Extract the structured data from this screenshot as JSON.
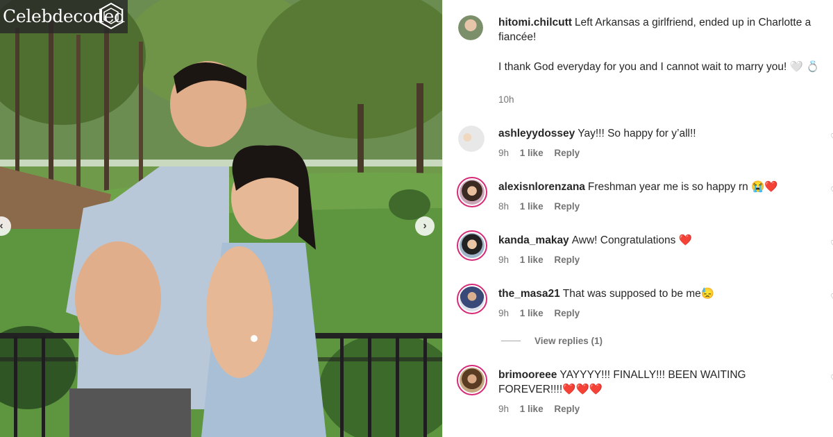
{
  "watermark": {
    "text": "Celebdecoded"
  },
  "photo": {
    "prev_icon": "chevron-left-icon",
    "next_icon": "chevron-right-icon"
  },
  "caption": {
    "username": "hitomi.chilcutt",
    "line1": "Left Arkansas a girlfriend, ended up in Charlotte a fiancée!",
    "line2": "I thank God everyday for you and I cannot wait to marry you! 🤍 💍",
    "time": "10h"
  },
  "comments": [
    {
      "username": "ashleyydossey",
      "text": "Yay!!! So happy for y’all!!",
      "time": "9h",
      "likes": "1 like",
      "reply": "Reply"
    },
    {
      "username": "alexisnlorenzana",
      "text": "Freshman year me is so happy rn 😭❤️",
      "time": "8h",
      "likes": "1 like",
      "reply": "Reply"
    },
    {
      "username": "kanda_makay",
      "text": "Aww! Congratulations ❤️",
      "time": "9h",
      "likes": "1 like",
      "reply": "Reply"
    },
    {
      "username": "the_masa21",
      "text": "That was supposed to be me😓",
      "time": "9h",
      "likes": "1 like",
      "reply": "Reply"
    },
    {
      "username": "brimooreee",
      "text": "YAYYYY!!! FINALLY!!! BEEN WAITING FOREVER!!!!❤️❤️❤️",
      "time": "9h",
      "likes": "1 like",
      "reply": "Reply"
    }
  ],
  "view_replies": "View replies (1)",
  "colors": {
    "ring": "#d62976",
    "muted": "#737373",
    "text": "#262626"
  }
}
